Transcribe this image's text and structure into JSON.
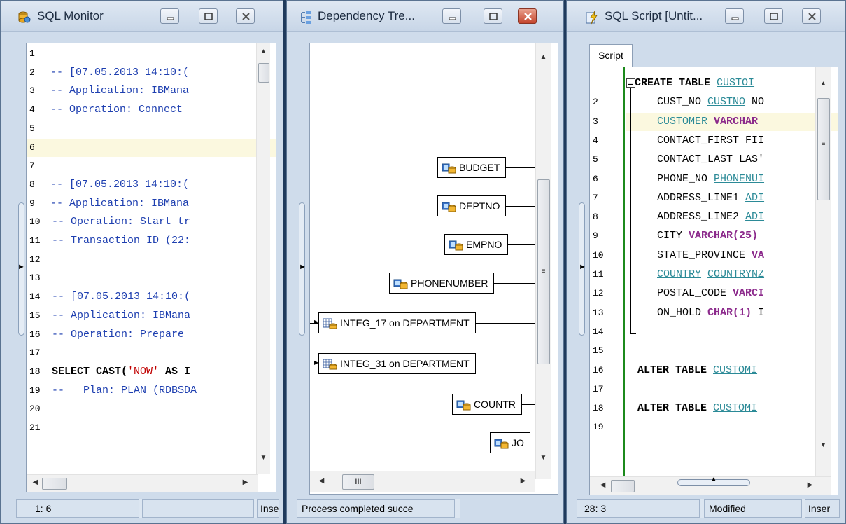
{
  "windows": {
    "sql_monitor": {
      "title": "SQL Monitor",
      "lines": [
        {
          "n": "1",
          "text": "",
          "cls": ""
        },
        {
          "n": "2",
          "text": "-- [07.05.2013 14:10:(",
          "cls": "cmt"
        },
        {
          "n": "3",
          "text": "-- Application: IBMana",
          "cls": "cmt"
        },
        {
          "n": "4",
          "text": "-- Operation: Connect",
          "cls": "cmt"
        },
        {
          "n": "5",
          "text": "",
          "cls": ""
        },
        {
          "n": "6",
          "text": "",
          "cls": "hl"
        },
        {
          "n": "7",
          "text": "",
          "cls": ""
        },
        {
          "n": "8",
          "text": "-- [07.05.2013 14:10:(",
          "cls": "cmt"
        },
        {
          "n": "9",
          "text": "-- Application: IBMana",
          "cls": "cmt"
        },
        {
          "n": "10",
          "text": "-- Operation: Start tr",
          "cls": "cmt"
        },
        {
          "n": "11",
          "text": "-- Transaction ID (22:",
          "cls": "cmt"
        },
        {
          "n": "12",
          "text": "",
          "cls": ""
        },
        {
          "n": "13",
          "text": "",
          "cls": ""
        },
        {
          "n": "14",
          "text": "-- [07.05.2013 14:10:(",
          "cls": "cmt"
        },
        {
          "n": "15",
          "text": "-- Application: IBMana",
          "cls": "cmt"
        },
        {
          "n": "16",
          "text": "-- Operation: Prepare",
          "cls": "cmt"
        },
        {
          "n": "17",
          "text": "",
          "cls": ""
        },
        {
          "n": "18",
          "text": "",
          "cls": "select"
        },
        {
          "n": "19",
          "text": "--   Plan: PLAN (RDB$DA",
          "cls": "cmt"
        },
        {
          "n": "20",
          "text": "",
          "cls": ""
        },
        {
          "n": "21",
          "text": "",
          "cls": ""
        }
      ],
      "select_kw": "SELECT CAST(",
      "select_str": "'NOW'",
      "select_rest": " AS I",
      "status": {
        "pos": "1:   6",
        "mid": "",
        "mode": "Inser"
      }
    },
    "dependency_tree": {
      "title": "Dependency Tre...",
      "nodes": [
        {
          "label": "BUDGET",
          "kind": "domain"
        },
        {
          "label": "DEPTNO",
          "kind": "domain"
        },
        {
          "label": "EMPNO",
          "kind": "domain"
        },
        {
          "label": "PHONENUMBER",
          "kind": "domain"
        },
        {
          "label": "INTEG_17 on DEPARTMENT",
          "kind": "constraint"
        },
        {
          "label": "INTEG_31 on DEPARTMENT",
          "kind": "constraint"
        },
        {
          "label": "COUNTR",
          "kind": "domain"
        },
        {
          "label": "JO",
          "kind": "domain"
        }
      ],
      "hscroll_label": "III",
      "status": {
        "text": "Process completed succe"
      }
    },
    "sql_script": {
      "title": "SQL Script [Untit...",
      "tab": "Script",
      "status": {
        "pos": "28:   3",
        "state": "Modified",
        "mode": "Inser"
      },
      "lines": [
        {
          "n": "",
          "parts": [
            {
              "t": "CREATE TABLE ",
              "c": "kw"
            },
            {
              "t": "CUSTOI",
              "c": "u-teal"
            }
          ]
        },
        {
          "n": "2",
          "parts": [
            {
              "t": "CUST_NO ",
              "c": "norm"
            },
            {
              "t": "CUSTNO",
              "c": "u-teal"
            },
            {
              "t": " NO",
              "c": "norm"
            }
          ]
        },
        {
          "n": "3",
          "parts": [
            {
              "t": "CUSTOMER",
              "c": "u-teal"
            },
            {
              "t": " VARCHAR",
              "c": "purple"
            }
          ],
          "hl": true
        },
        {
          "n": "4",
          "parts": [
            {
              "t": "CONTACT_FIRST FII",
              "c": "norm"
            }
          ]
        },
        {
          "n": "5",
          "parts": [
            {
              "t": "CONTACT_LAST LAS'",
              "c": "norm"
            }
          ]
        },
        {
          "n": "6",
          "parts": [
            {
              "t": "PHONE_NO ",
              "c": "norm"
            },
            {
              "t": "PHONENUI",
              "c": "u-teal"
            }
          ]
        },
        {
          "n": "7",
          "parts": [
            {
              "t": "ADDRESS_LINE1 ",
              "c": "norm"
            },
            {
              "t": "ADI",
              "c": "u-teal"
            }
          ]
        },
        {
          "n": "8",
          "parts": [
            {
              "t": "ADDRESS_LINE2 ",
              "c": "norm"
            },
            {
              "t": "ADI",
              "c": "u-teal"
            }
          ]
        },
        {
          "n": "9",
          "parts": [
            {
              "t": "CITY ",
              "c": "norm"
            },
            {
              "t": "VARCHAR(25)",
              "c": "purple"
            }
          ]
        },
        {
          "n": "10",
          "parts": [
            {
              "t": "STATE_PROVINCE ",
              "c": "norm"
            },
            {
              "t": "VA",
              "c": "purple"
            }
          ]
        },
        {
          "n": "11",
          "parts": [
            {
              "t": "COUNTRY",
              "c": "u-teal"
            },
            {
              "t": " ",
              "c": "norm"
            },
            {
              "t": "COUNTRYNZ",
              "c": "u-teal"
            }
          ]
        },
        {
          "n": "12",
          "parts": [
            {
              "t": "POSTAL_CODE ",
              "c": "norm"
            },
            {
              "t": "VARCI",
              "c": "purple"
            }
          ]
        },
        {
          "n": "13",
          "parts": [
            {
              "t": "ON_HOLD ",
              "c": "norm"
            },
            {
              "t": "CHAR(1)",
              "c": "purple"
            },
            {
              "t": " I",
              "c": "norm"
            }
          ]
        },
        {
          "n": "14",
          "parts": []
        },
        {
          "n": "15",
          "parts": []
        },
        {
          "n": "16",
          "parts": [
            {
              "t": "ALTER TABLE ",
              "c": "kw"
            },
            {
              "t": "CUSTOMI",
              "c": "u-teal"
            }
          ]
        },
        {
          "n": "17",
          "parts": []
        },
        {
          "n": "18",
          "parts": [
            {
              "t": "ALTER TABLE ",
              "c": "kw"
            },
            {
              "t": "CUSTOMI",
              "c": "u-teal"
            }
          ]
        },
        {
          "n": "19",
          "parts": []
        }
      ]
    }
  }
}
